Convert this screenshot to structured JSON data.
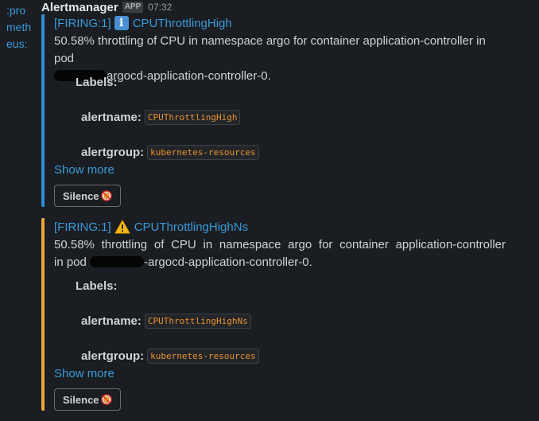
{
  "avatar": {
    "lines": [
      ":pro",
      "meth",
      "eus:"
    ]
  },
  "message": {
    "sender": "Alertmanager",
    "badge": "APP",
    "time": "07:32"
  },
  "alerts": [
    {
      "severity": "info",
      "firing": "[FIRING:1]",
      "title": "CPUThrottlingHigh",
      "desc_line1": "50.58% throttling of CPU in namespace argo for container application-controller in pod",
      "desc_line2": "argocd-application-controller-0.",
      "labels_heading": "Labels:",
      "labels": [
        {
          "key": "alertname:",
          "value": "CPUThrottlingHigh"
        },
        {
          "key": "alertgroup:",
          "value": "kubernetes-resources"
        }
      ],
      "show_more": "Show more",
      "silence_label": "Silence"
    },
    {
      "severity": "warning",
      "firing": "[FIRING:1]",
      "title": "CPUThrottlingHighNs",
      "desc_line1": "50.58% throttling of CPU in namespace argo for container application-controller",
      "desc_line2_pre": "in pod",
      "desc_line2_post": "-argocd-application-controller-0.",
      "labels_heading": "Labels:",
      "labels": [
        {
          "key": "alertname:",
          "value": "CPUThrottlingHighNs"
        },
        {
          "key": "alertgroup:",
          "value": "kubernetes-resources"
        }
      ],
      "show_more": "Show more",
      "silence_label": "Silence"
    }
  ],
  "colors": {
    "background": "#1a1d21",
    "link": "#3a9ad9",
    "info_bar": "#2e8fd6",
    "warning_bar": "#e8a43d",
    "code_text": "#e8912d"
  }
}
